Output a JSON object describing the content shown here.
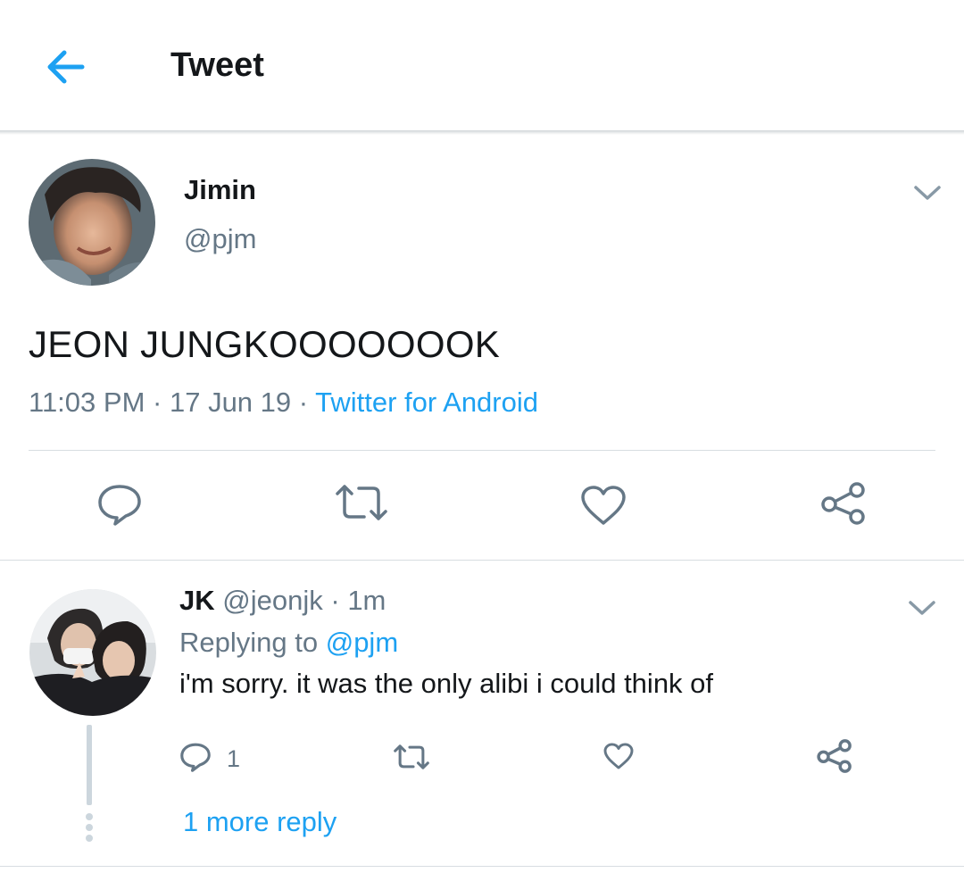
{
  "header": {
    "title": "Tweet",
    "back_icon": "back-arrow-icon"
  },
  "colors": {
    "accent": "#1da1f2",
    "secondary_text": "#657786",
    "primary_text": "#14171a",
    "icon_gray": "#657786"
  },
  "main_tweet": {
    "name": "Jimin",
    "handle": "@pjm",
    "text": "JEON JUNGKOOOOOOOK",
    "time": "11:03 PM",
    "sep1": "·",
    "date": "17 Jun 19",
    "sep2": "·",
    "source": "Twitter for Android",
    "actions": [
      "reply-icon",
      "retweet-icon",
      "like-icon",
      "share-icon"
    ]
  },
  "reply": {
    "name": "JK",
    "handle": "@jeonjk",
    "sep": "·",
    "time": "1m",
    "replying_prefix": "Replying to",
    "replying_to": "@pjm",
    "text": "i'm sorry. it was the only alibi i could think of",
    "reply_count": "1",
    "actions": [
      "reply-icon",
      "retweet-icon",
      "like-icon",
      "share-icon"
    ]
  },
  "thread": {
    "more_reply": "1 more reply"
  }
}
